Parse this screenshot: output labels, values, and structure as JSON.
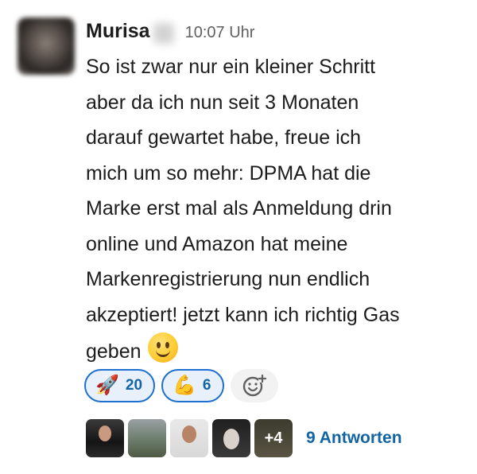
{
  "message": {
    "author": "Murisa",
    "time": "10:07 Uhr",
    "lines": [
      "So ist zwar nur ein kleiner Schritt",
      "aber da ich nun seit 3 Monaten",
      "darauf gewartet habe, freue ich",
      "mich um so mehr: DPMA hat die",
      "Marke erst mal als Anmeldung drin",
      "online und Amazon hat meine",
      "Markenregistrierung nun endlich",
      "akzeptiert! jetzt kann ich richtig Gas",
      "geben"
    ],
    "inline_emoji": "slightly-smiling-face"
  },
  "reactions": [
    {
      "emoji": "🚀",
      "icon": "rocket-icon",
      "count": "20"
    },
    {
      "emoji": "💪",
      "icon": "flexed-biceps-icon",
      "count": "6"
    }
  ],
  "add_reaction_icon": "add-emoji-icon",
  "thread": {
    "more_count": "+4",
    "reply_label": "9 Antworten"
  },
  "colors": {
    "accent": "#1264a3",
    "reaction_border": "#1d6fd0",
    "reaction_bg": "#e8f1fb"
  }
}
